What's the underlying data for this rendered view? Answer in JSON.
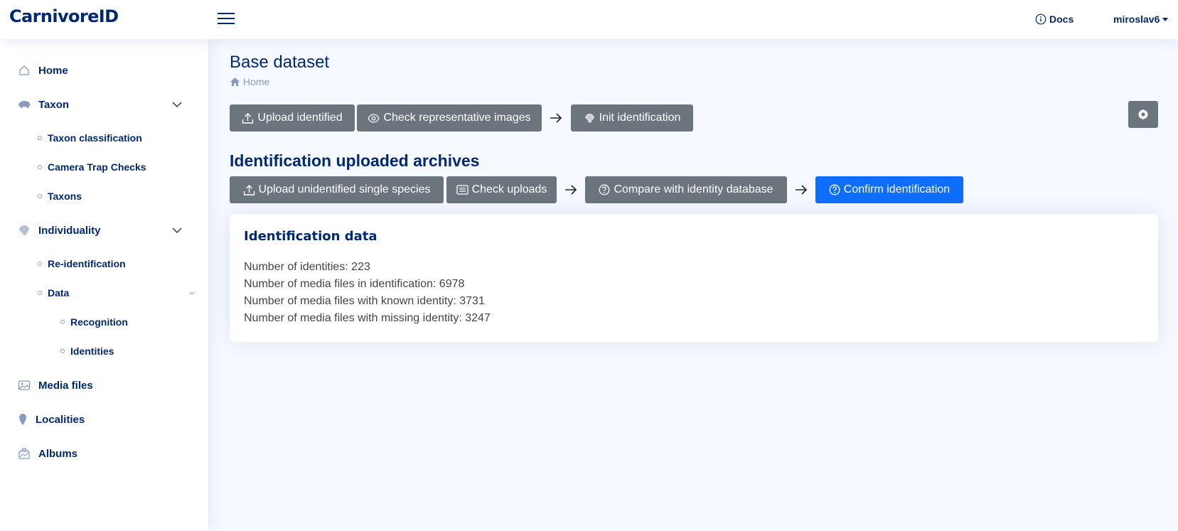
{
  "app": {
    "logo": "CarnivoreID"
  },
  "header": {
    "docs_label": "Docs",
    "user_name": "miroslav6"
  },
  "sidebar": {
    "home": "Home",
    "taxon": "Taxon",
    "taxon_items": [
      "Taxon classification",
      "Camera Trap Checks",
      "Taxons"
    ],
    "individuality": "Individuality",
    "individuality_items": [
      "Re-identification",
      "Data"
    ],
    "data_items": [
      "Recognition",
      "Identities"
    ],
    "media_files": "Media files",
    "localities": "Localities",
    "albums": "Albums"
  },
  "page": {
    "title": "Base dataset",
    "breadcrumb": "Home"
  },
  "toolbar1": {
    "upload_identified": "Upload identified",
    "check_representative": "Check representative images",
    "init_identification": "Init identification"
  },
  "section": {
    "title": "Identification uploaded archives"
  },
  "toolbar2": {
    "upload_unidentified": "Upload unidentified single species",
    "check_uploads": "Check uploads",
    "compare_identity": "Compare with identity database",
    "confirm_identification": "Confirm identification"
  },
  "card": {
    "title": "Identification data",
    "stats": [
      "Number of identities: 223",
      "Number of media files in identification: 6978",
      "Number of media files with known identity: 3731",
      "Number of media files with missing identity: 3247"
    ]
  },
  "colors": {
    "navy": "#012970",
    "secondary_button": "#6c757d",
    "primary_button": "#0d6efd",
    "page_background": "#f6f9ff"
  }
}
